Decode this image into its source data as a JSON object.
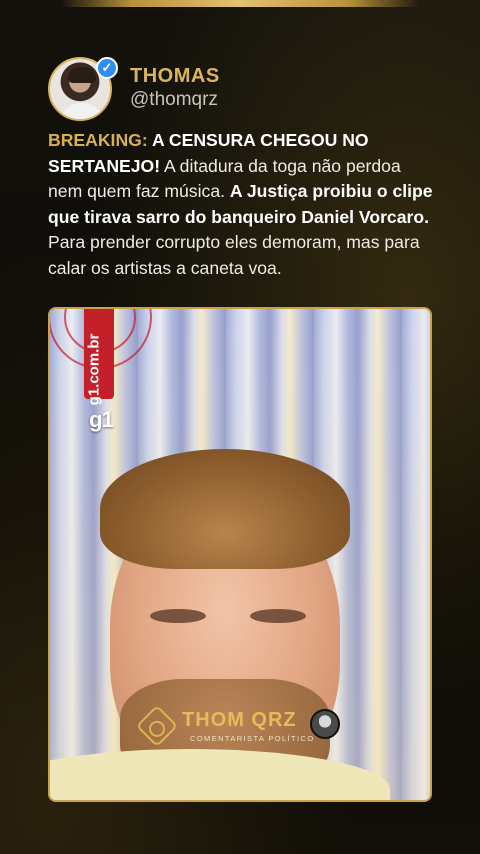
{
  "profile": {
    "name": "THOMAS",
    "handle": "@thomqrz",
    "avatar_icon": "profile-photo",
    "verified_icon": "verified-badge-icon",
    "verified_color": "#2d8ff0"
  },
  "tweet": {
    "p1": "BREAKING:",
    "p2": " A CENSURA CHEGOU NO SERTANEJO!",
    "p3": " A ditadura da toga não perdoa nem quem faz música. ",
    "p4": "A Justiça proibiu o clipe que tirava sarro do banqueiro Daniel Vorcaro.",
    "p5": " Para prender corrupto eles demoram, mas para calar os artistas a caneta voa."
  },
  "media": {
    "source_url": "g1.com.br",
    "source_logo": "g1",
    "brand_color": "#c4202a"
  },
  "watermark": {
    "title": "THOM QRZ",
    "subtitle": "COMENTARISTA POLÍTICO",
    "icon": "lion-emblem-icon",
    "accent": "#e9b95a"
  },
  "theme": {
    "gold": "#d9b04f",
    "background": "#0b0a08"
  }
}
